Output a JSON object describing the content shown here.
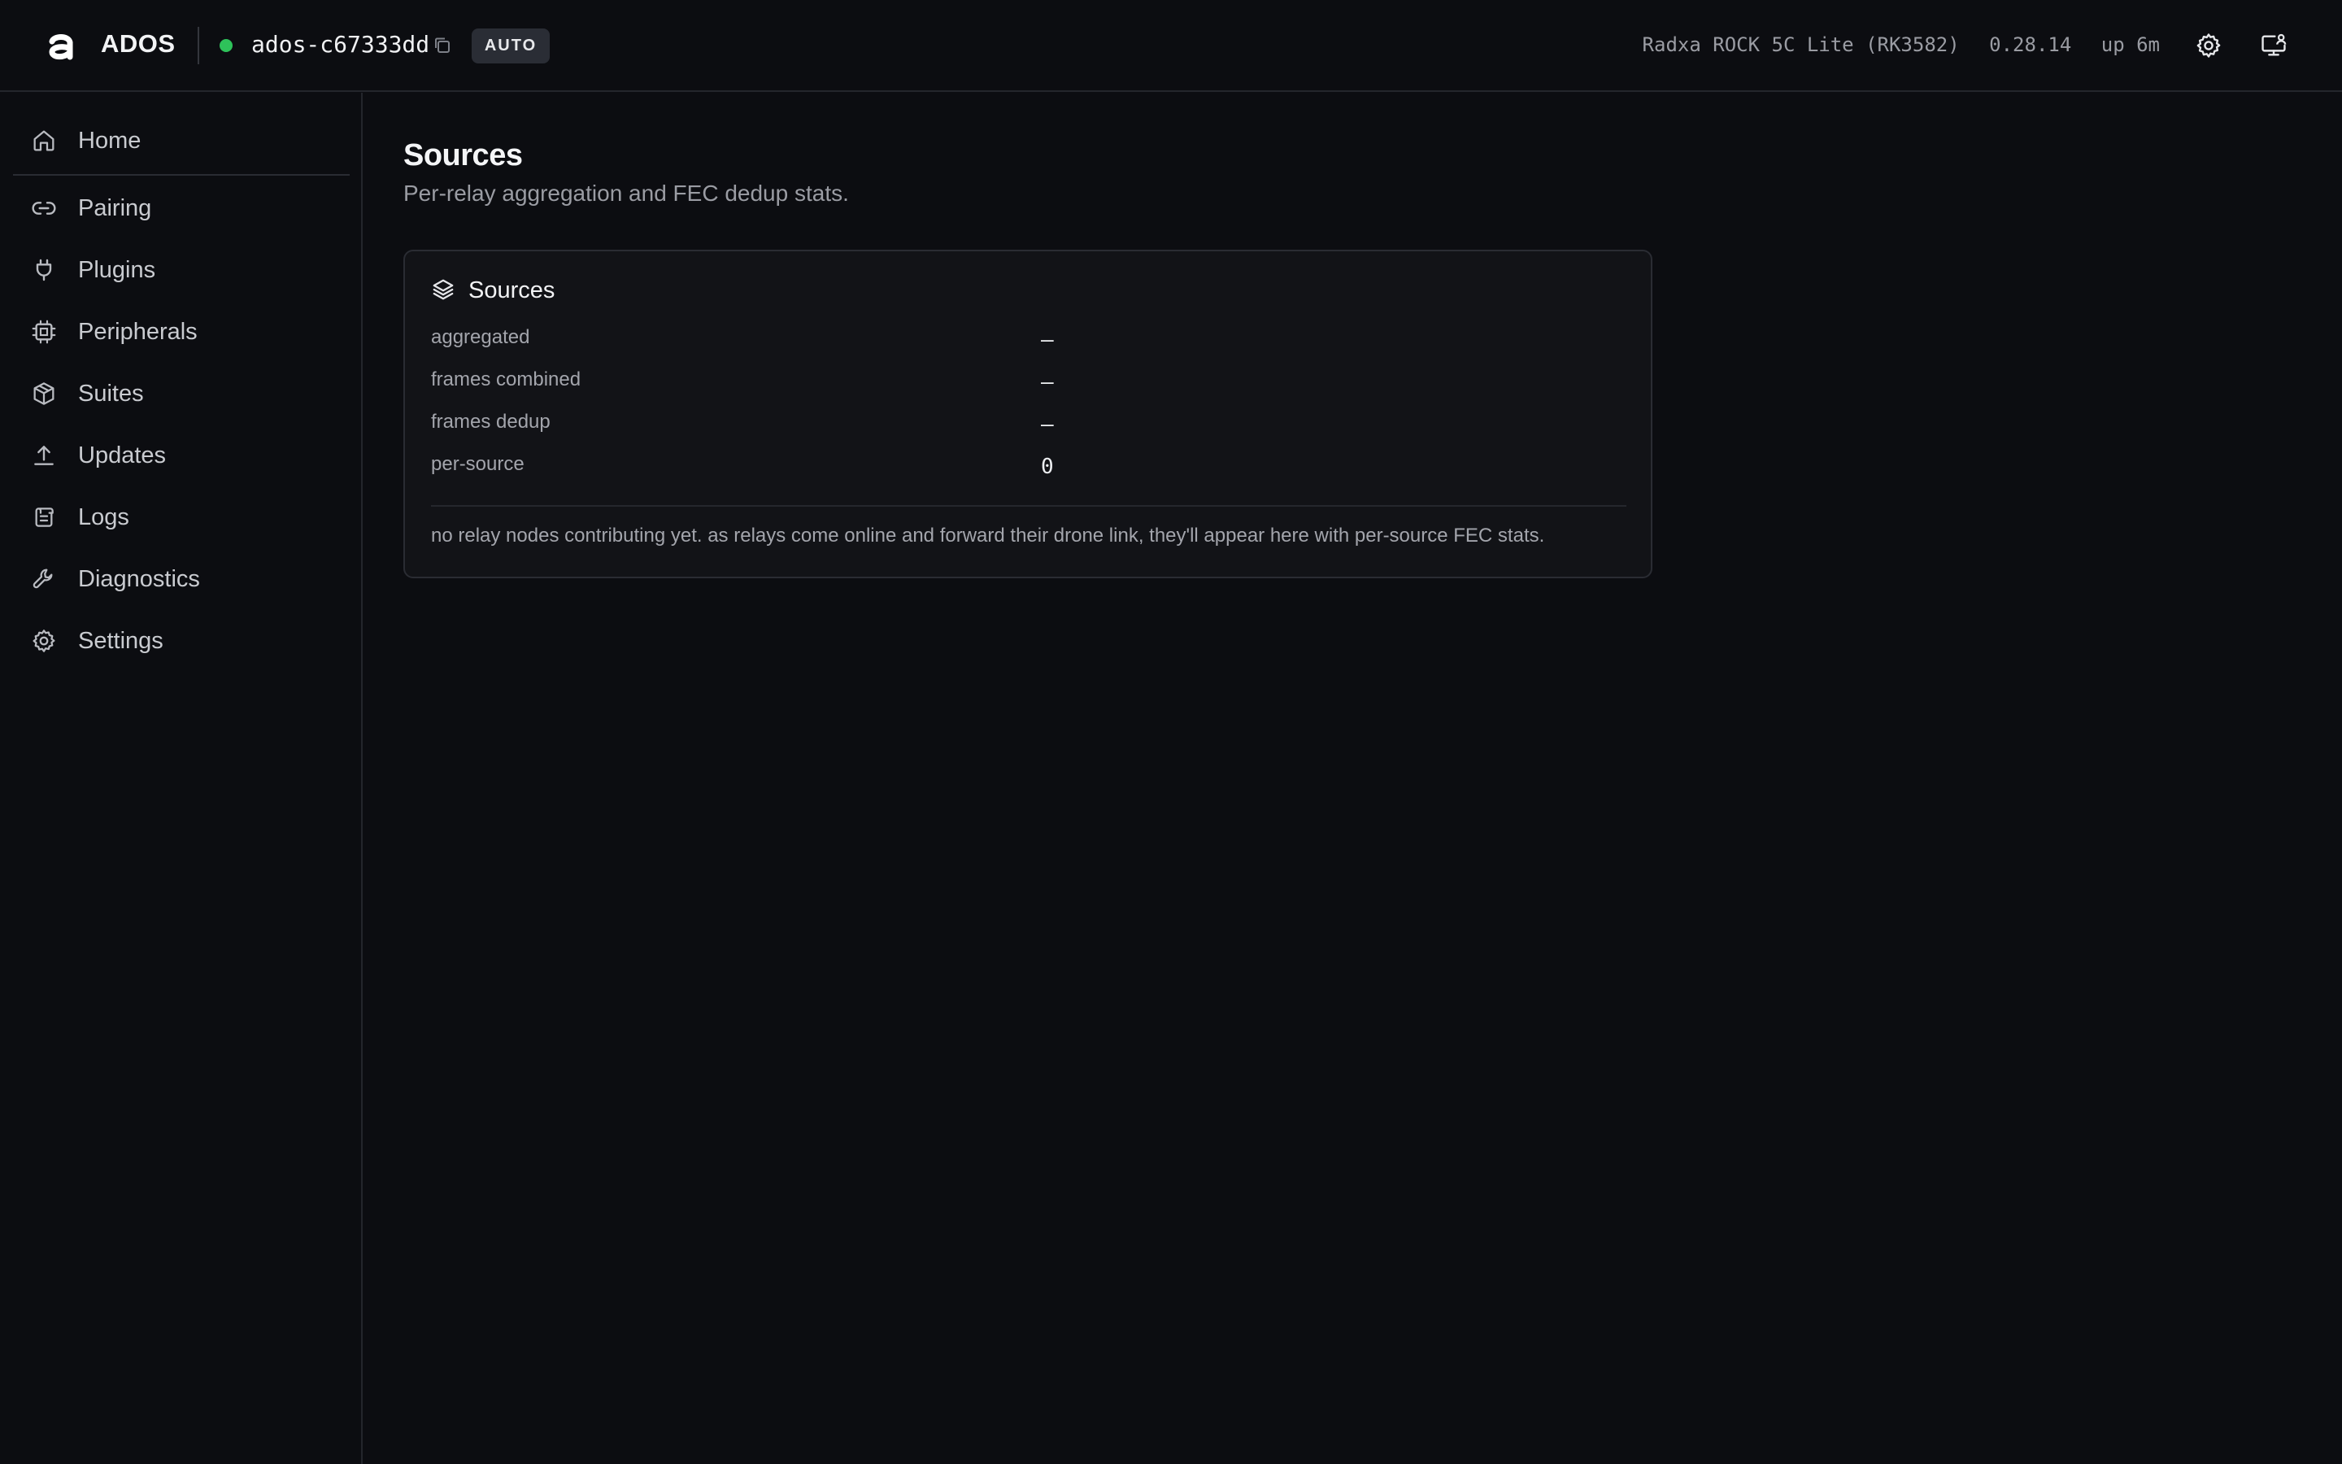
{
  "header": {
    "app_name": "ADOS",
    "device_name": "ados-c67333dd",
    "mode_badge": "AUTO",
    "status_color": "#2ec25a",
    "hardware": "Radxa ROCK 5C Lite (RK3582)",
    "version": "0.28.14",
    "uptime": "up 6m",
    "icons": [
      "copy-icon",
      "gear-icon",
      "monitor-user-icon"
    ]
  },
  "sidebar": {
    "items": [
      {
        "label": "Home",
        "icon": "home-icon"
      },
      {
        "label": "Pairing",
        "icon": "link-icon"
      },
      {
        "label": "Plugins",
        "icon": "plug-icon"
      },
      {
        "label": "Peripherals",
        "icon": "chip-icon"
      },
      {
        "label": "Suites",
        "icon": "package-icon"
      },
      {
        "label": "Updates",
        "icon": "upload-icon"
      },
      {
        "label": "Logs",
        "icon": "scroll-icon"
      },
      {
        "label": "Diagnostics",
        "icon": "wrench-icon"
      },
      {
        "label": "Settings",
        "icon": "gear-icon"
      }
    ]
  },
  "main": {
    "title": "Sources",
    "subtitle": "Per-relay aggregation and FEC dedup stats.",
    "card": {
      "title": "Sources",
      "icon": "layers-icon",
      "stats": [
        {
          "label": "aggregated",
          "value": "—"
        },
        {
          "label": "frames combined",
          "value": "—"
        },
        {
          "label": "frames dedup",
          "value": "—"
        },
        {
          "label": "per-source",
          "value": "0"
        }
      ],
      "note": "no relay nodes contributing yet. as relays come online and forward their drone link, they'll appear here with per-source FEC stats."
    }
  }
}
